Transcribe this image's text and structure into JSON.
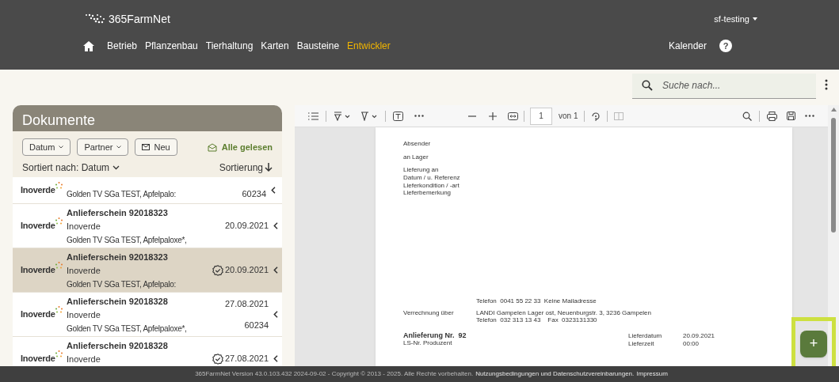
{
  "header": {
    "logo": "365FarmNet",
    "user": "sf-testing",
    "nav": [
      {
        "label": "Betrieb",
        "selected": false
      },
      {
        "label": "Pflanzenbau",
        "selected": false
      },
      {
        "label": "Tierhaltung",
        "selected": false
      },
      {
        "label": "Karten",
        "selected": false
      },
      {
        "label": "Bausteine",
        "selected": false
      },
      {
        "label": "Entwickler",
        "selected": true
      }
    ],
    "calendar": "Kalender",
    "help": "?"
  },
  "search": {
    "placeholder": "Suche nach..."
  },
  "documents": {
    "title": "Dokumente",
    "filters": [
      {
        "label": "Datum",
        "kind": "dropdown"
      },
      {
        "label": "Partner",
        "kind": "dropdown"
      },
      {
        "label": "Neu",
        "kind": "mail"
      }
    ],
    "mark_all": "Alle gelesen",
    "sort_label": "Sortiert nach: Datum",
    "sort_order": "Sortierung",
    "rows": [
      {
        "kind": "partial",
        "logo": "Inoverde",
        "detail": "Golden TV SGa TEST, Apfelpalo:",
        "number": "60234",
        "selected": false
      },
      {
        "kind": "full",
        "logo": "Inoverde",
        "title": "Anlieferschein 92018323",
        "partner": "Inoverde",
        "detail": "Golden TV SGa TEST, Apfelpaloxe*,",
        "date": "20.09.2021",
        "verified": false,
        "selected": false
      },
      {
        "kind": "full",
        "logo": "Inoverde",
        "title": "Anlieferschein 92018323",
        "partner": "Inoverde",
        "detail": "Golden TV SGa TEST, Apfelpalo:",
        "date": "20.09.2021",
        "verified": true,
        "selected": true
      },
      {
        "kind": "full",
        "logo": "Inoverde",
        "title": "Anlieferschein 92018328",
        "partner": "Inoverde",
        "detail": "Golden TV SGa TEST, Apfelpaloxe*,",
        "date": "27.08.2021",
        "number": "60234",
        "verified": false,
        "selected": false
      },
      {
        "kind": "full",
        "logo": "Inoverde",
        "title": "Anlieferschein 92018328",
        "partner": "Inoverde",
        "date": "27.08.2021",
        "verified": true,
        "selected": false
      }
    ]
  },
  "viewer": {
    "page": "1",
    "page_total": "von 1",
    "doc_top": [
      "Absender",
      "an Lager",
      "Lieferung an",
      "Datum / u. Referenz",
      "Lieferkondition / -art",
      "Lieferbemerkung"
    ],
    "contact": "Telefon  0041 55 22 33  Keine Mailadresse",
    "billing_label": "Verrechnung über",
    "billing_address": "LANDI Gampelen Lager ost, Neuenburgstr. 3, 3236 Gampelen",
    "billing_phone": "Telefon  032 313 13 43    Fax  0323131330",
    "heading": "Anlieferung Nr.  92",
    "producer_label": "LS-Nr. Produzent",
    "fields": [
      {
        "label": "Lieferdatum",
        "value": "20.09.2021"
      },
      {
        "label": "Lieferzeit",
        "value": "00:00"
      }
    ]
  },
  "fab": "+",
  "footer": {
    "text": "365FarmNet Version 43.0.103.432 2024-09-02 - Copyright © 2013 - 2025. Alle Rechte vorbehalten.",
    "links": [
      "Nutzungsbedingungen und Datenschutzvereinbarungen.",
      "Impressum"
    ]
  }
}
